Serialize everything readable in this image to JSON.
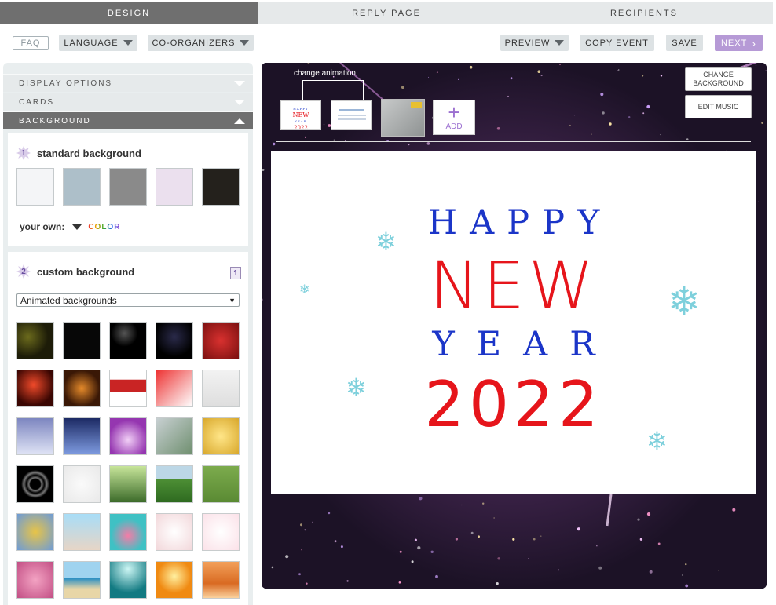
{
  "tabs": [
    "DESIGN",
    "REPLY PAGE",
    "RECIPIENTS"
  ],
  "toolbar": {
    "faq": "FAQ",
    "language": "LANGUAGE",
    "coorganizers": "CO-ORGANIZERS",
    "preview": "PREVIEW",
    "copy_event": "COPY EVENT",
    "save": "SAVE",
    "next": "NEXT"
  },
  "sidebar": {
    "sections": [
      "DISPLAY OPTIONS",
      "CARDS",
      "BACKGROUND"
    ],
    "standard": {
      "number": "1",
      "title": "standard background",
      "swatches": [
        "#f4f5f7",
        "#adbfc9",
        "#8a8a8a",
        "#ebe0ee",
        "#24211c"
      ],
      "your_own": "your own:",
      "color_label": "COLOR"
    },
    "custom": {
      "number": "2",
      "title": "custom background",
      "page_indicator": "1",
      "select_value": "Animated backgrounds",
      "thumbs": [
        {
          "name": "dark-bokeh",
          "bg": "radial-gradient(circle at 30% 40%,#6b6a1c,#1d1c08 60%)"
        },
        {
          "name": "black",
          "bg": "#070707"
        },
        {
          "name": "starry-snow",
          "bg": "radial-gradient(circle at 40% 30%,#555 0,#000 40%)"
        },
        {
          "name": "colored-stars",
          "bg": "radial-gradient(circle at 50% 40%,#2a2a4a,#000 70%)"
        },
        {
          "name": "red-glitter",
          "bg": "radial-gradient(circle at 50% 50%,#d9312f,#7a1010)"
        },
        {
          "name": "candle",
          "bg": "radial-gradient(circle at 45% 40%,#f04a2a,#3a0602 70%)"
        },
        {
          "name": "christmas-lights",
          "bg": "radial-gradient(circle at 50% 50%,#e58a2a,#3a1806 70%)"
        },
        {
          "name": "dancing-santas",
          "bg": "linear-gradient(#fff 0,#fff 25%,#c92424 26%,#c92424 60%,#fff 61%)"
        },
        {
          "name": "santa-bag",
          "bg": "linear-gradient(135deg,#e33 0,#f7b0b0 60%,#fff 100%)"
        },
        {
          "name": "christmas-tree",
          "bg": "linear-gradient(#f2f2f2,#dedede)"
        },
        {
          "name": "snowy-forest",
          "bg": "linear-gradient(#7d86c0,#dfe3f5)"
        },
        {
          "name": "winter-cabin",
          "bg": "linear-gradient(#1c2a64,#7e9be0)"
        },
        {
          "name": "purple-sparkle",
          "bg": "radial-gradient(circle at 50% 60%,#f1cff6,#9536b0 70%)"
        },
        {
          "name": "champagne-spray",
          "bg": "linear-gradient(135deg,#c8d0d2,#6f8f6f)"
        },
        {
          "name": "champagne-bubbles",
          "bg": "radial-gradient(circle at 50% 50%,#ffe689,#d8a72a)"
        },
        {
          "name": "hypnotic-rings",
          "bg": "radial-gradient(circle,#000 0,#000 20%,#777 25%,#000 35%,#777 45%,#000 55%)"
        },
        {
          "name": "confetti-white",
          "bg": "radial-gradient(circle at 50% 50%,#fafafa,#e9e9e9)"
        },
        {
          "name": "sunny-forest",
          "bg": "linear-gradient(#c7e59a,#3c6b2a)"
        },
        {
          "name": "green-field",
          "bg": "linear-gradient(#bcd7e6 0,#bcd7e6 35%,#4d8f35 36%,#2e6a20)"
        },
        {
          "name": "grass-meadow",
          "bg": "linear-gradient(#7cab4d,#5a8a33)"
        },
        {
          "name": "balloons",
          "bg": "radial-gradient(circle at 50% 50%,#e8c447,#6c9bd8)"
        },
        {
          "name": "birthday-candles",
          "bg": "linear-gradient(#a8ddf7,#e7d5c6)"
        },
        {
          "name": "cupcake",
          "bg": "radial-gradient(circle at 50% 60%,#f47ca7,#3fc1c4 60%)"
        },
        {
          "name": "rose-petals",
          "bg": "radial-gradient(circle at 50% 50%,#fff,#f2d7da)"
        },
        {
          "name": "pink-petals",
          "bg": "radial-gradient(circle at 50% 50%,#fff,#fbe1e8)"
        },
        {
          "name": "pink-roses",
          "bg": "radial-gradient(circle at 50% 50%,#f3a3c3,#c24e84)"
        },
        {
          "name": "beach",
          "bg": "linear-gradient(#9fd3ef 0,#9fd3ef 45%,#2c8fc2 46%,#e8d6a7 75%)"
        },
        {
          "name": "underwater",
          "bg": "radial-gradient(circle at 50% 20%,#cdf6f4,#127a82 70%)"
        },
        {
          "name": "sunset-golf",
          "bg": "radial-gradient(circle at 50% 40%,#fff0a0,#f08a12 60%)"
        },
        {
          "name": "sea-sunset",
          "bg": "linear-gradient(#f2a05a,#d96a22 60%,#fbd29e)"
        }
      ]
    }
  },
  "stage": {
    "change_animation_label": "change animation",
    "change_background": "CHANGE BACKGROUND",
    "edit_music": "EDIT MUSIC",
    "add_label": "ADD",
    "mini_card": {
      "line1": "HAPPY",
      "line2": "NEW",
      "line3": "YEAR",
      "line4": "2022"
    },
    "card": {
      "happy": "HAPPY",
      "new": "NEW",
      "year": "YEAR",
      "year_num": "2022",
      "colors": {
        "blue": "#1b35c8",
        "red": "#e6151b",
        "snowflake": "#7ed0dc"
      }
    }
  }
}
